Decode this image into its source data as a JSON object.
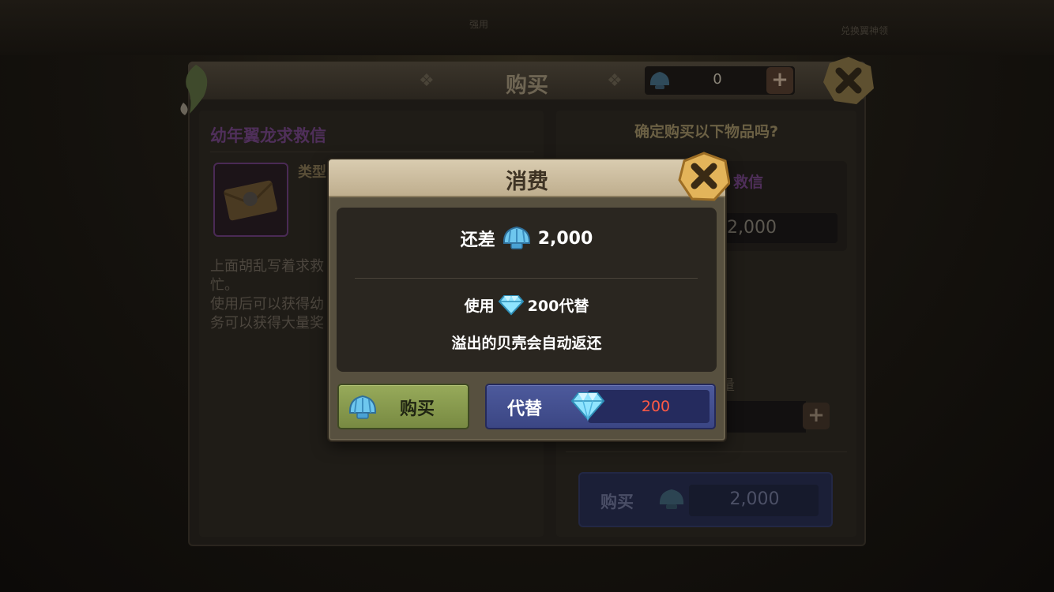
{
  "background": {
    "top_text_left": "强用",
    "top_text_right": "兑换翼神领"
  },
  "shop_panel": {
    "title": "购买",
    "currency_value": "0",
    "plus_label": "+",
    "item_name": "幼年翼龙求救信",
    "type_label": "类型",
    "description_lines": [
      "上面胡乱写着求救",
      "忙。",
      "使用后可以获得幼",
      "务可以获得大量奖"
    ],
    "confirm_question": "确定购买以下物品吗?",
    "right_item_name": "救信",
    "right_price": "2,000",
    "quantity_label": "量",
    "quantity_plus": "+",
    "buy_label": "购买",
    "buy_price": "2,000"
  },
  "modal": {
    "title": "消费",
    "shortfall_label": "还差",
    "shortfall_amount": "2,000",
    "use_label": "使用",
    "substitute_amount": "200代替",
    "refund_note": "溢出的贝壳会自动返还",
    "buy_button_label": "购买",
    "substitute_button_label": "代替",
    "substitute_price": "200"
  },
  "icons": {
    "shell": "shell-currency-icon",
    "diamond": "diamond-currency-icon",
    "close": "close-icon"
  },
  "colors": {
    "buy_button": "#8a9c4e",
    "substitute_button": "#4552911",
    "price_red": "#ff5a45",
    "item_purple": "#4f2f5a"
  }
}
